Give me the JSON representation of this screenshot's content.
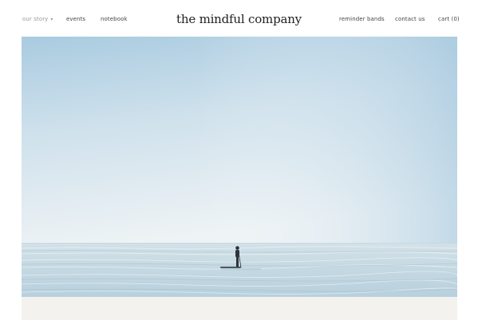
{
  "header": {
    "brand": "the mindful company",
    "nav_left": [
      {
        "label": "our story",
        "has_dropdown": true,
        "muted": true
      },
      {
        "label": "events"
      },
      {
        "label": "notebook"
      }
    ],
    "nav_right": [
      {
        "label": "reminder bands"
      },
      {
        "label": "contact us"
      },
      {
        "label": "cart (0)"
      }
    ]
  },
  "icons": {
    "dropdown": "chevron-down-icon"
  },
  "colors": {
    "sky_top": "#b0cfe3",
    "sky_horizon": "#eef3f5",
    "sea": "#c2d6e0",
    "footer_band": "#f3f2ef",
    "brand_text": "#1f1f1f",
    "nav_text": "#444444",
    "nav_muted": "#9a9a9a"
  }
}
